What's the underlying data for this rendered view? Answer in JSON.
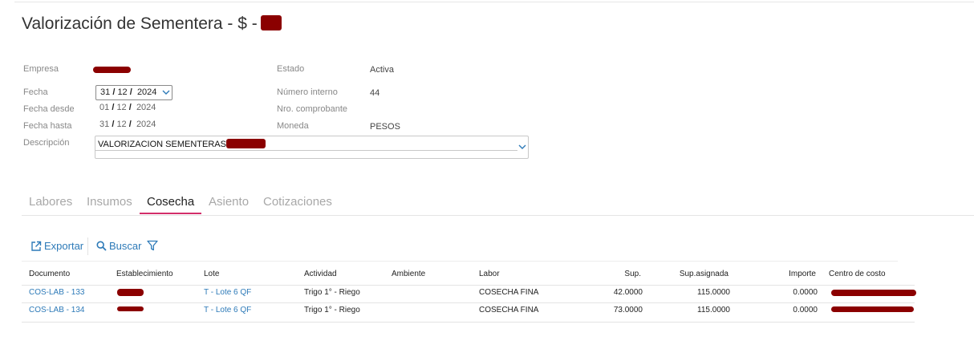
{
  "header": {
    "title": "Valorización de Sementera - $ -"
  },
  "form": {
    "empresa_label": "Empresa",
    "estado_label": "Estado",
    "estado_value": "Activa",
    "fecha_label": "Fecha",
    "fecha": {
      "dd": "31",
      "mm": "12",
      "yyyy": "2024"
    },
    "numero_interno_label": "Número interno",
    "numero_interno_value": "44",
    "fecha_desde_label": "Fecha desde",
    "fecha_desde": {
      "dd": "01",
      "mm": "12",
      "yyyy": "2024"
    },
    "nro_comprobante_label": "Nro. comprobante",
    "fecha_hasta_label": "Fecha hasta",
    "fecha_hasta": {
      "dd": "31",
      "mm": "12",
      "yyyy": "2024"
    },
    "moneda_label": "Moneda",
    "moneda_value": "PESOS",
    "descripcion_label": "Descripción",
    "descripcion_value": "VALORIZACION SEMENTERAS",
    "date_sep": "/"
  },
  "tabs": [
    {
      "label": "Labores",
      "active": false
    },
    {
      "label": "Insumos",
      "active": false
    },
    {
      "label": "Cosecha",
      "active": true
    },
    {
      "label": "Asiento",
      "active": false
    },
    {
      "label": "Cotizaciones",
      "active": false
    }
  ],
  "toolbar": {
    "export_label": "Exportar",
    "search_label": "Buscar"
  },
  "table": {
    "columns": [
      "Documento",
      "Establecimiento",
      "Lote",
      "Actividad",
      "Ambiente",
      "Labor",
      "Sup.",
      "Sup.asignada",
      "Importe",
      "Centro de costo"
    ],
    "rows": [
      {
        "documento": "COS-LAB - 133",
        "lote": "T - Lote 6 QF",
        "actividad": "Trigo 1° - Riego",
        "ambiente": "",
        "labor": "COSECHA FINA",
        "sup": "42.0000",
        "sup_asignada": "115.0000",
        "importe": "0.0000"
      },
      {
        "documento": "COS-LAB - 134",
        "lote": "T - Lote 6 QF",
        "actividad": "Trigo 1° - Riego",
        "ambiente": "",
        "labor": "COSECHA FINA",
        "sup": "73.0000",
        "sup_asignada": "115.0000",
        "importe": "0.0000"
      }
    ]
  },
  "colors": {
    "accent": "#2d7ab8",
    "tab_active_underline": "#d32f6a",
    "redaction": "#8b0000"
  },
  "icons": {
    "export": "external-link-icon",
    "search": "search-icon",
    "filter": "filter-icon",
    "dropdown": "chevron-down-icon"
  }
}
